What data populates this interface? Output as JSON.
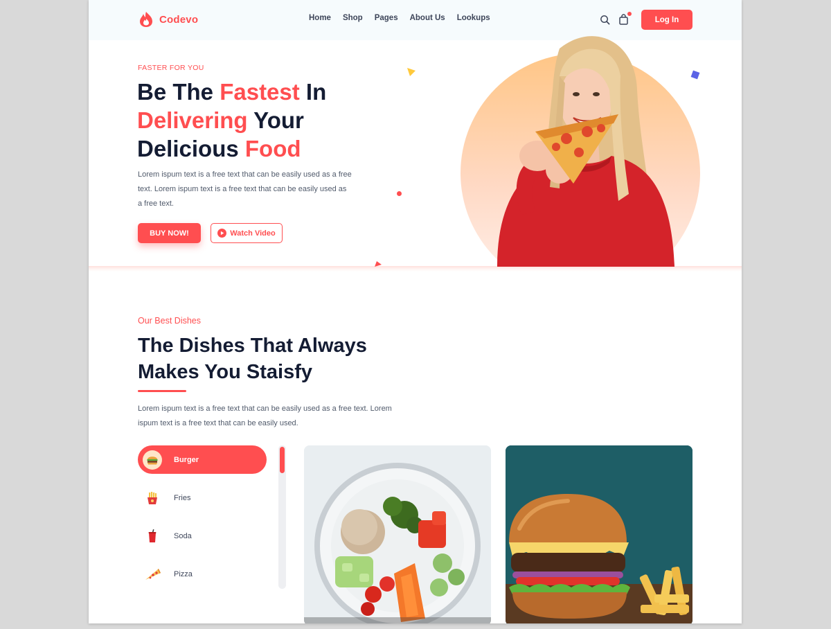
{
  "brand": {
    "name": "Codevo",
    "accent": "#ff4e50",
    "dark": "#141c33"
  },
  "nav": {
    "items": [
      "Home",
      "Shop",
      "Pages",
      "About Us",
      "Lookups"
    ],
    "search_icon": "search-icon",
    "cart_icon": "shopping-bag-icon",
    "login_label": "Log In"
  },
  "hero": {
    "eyebrow": "FASTER FOR YOU",
    "title_parts": {
      "w1": "Be The ",
      "w2": "Fastest",
      "w3": " In",
      "w4": "Delivering",
      "w5": " Your",
      "w6": "Delicious ",
      "w7": "Food"
    },
    "description": "Lorem ispum text is a free text that can be easily used as a free text. Lorem ispum text is a free text that can be easily used as a free text.",
    "buy_label": "BUY NOW!",
    "watch_label": "Watch Video"
  },
  "dishes": {
    "eyebrow": "Our Best Dishes",
    "title_line1": "The Dishes That Always",
    "title_line2": "Makes You Staisfy",
    "description": "Lorem ispum text is a free text that can be easily used as a free text. Lorem ispum text is a free text that can be easily used.",
    "categories": [
      {
        "label": "Burger",
        "icon": "burger-icon",
        "active": true
      },
      {
        "label": "Fries",
        "icon": "fries-icon",
        "active": false
      },
      {
        "label": "Soda",
        "icon": "soda-icon",
        "active": false
      },
      {
        "label": "Pizza",
        "icon": "pizza-icon",
        "active": false
      }
    ]
  }
}
